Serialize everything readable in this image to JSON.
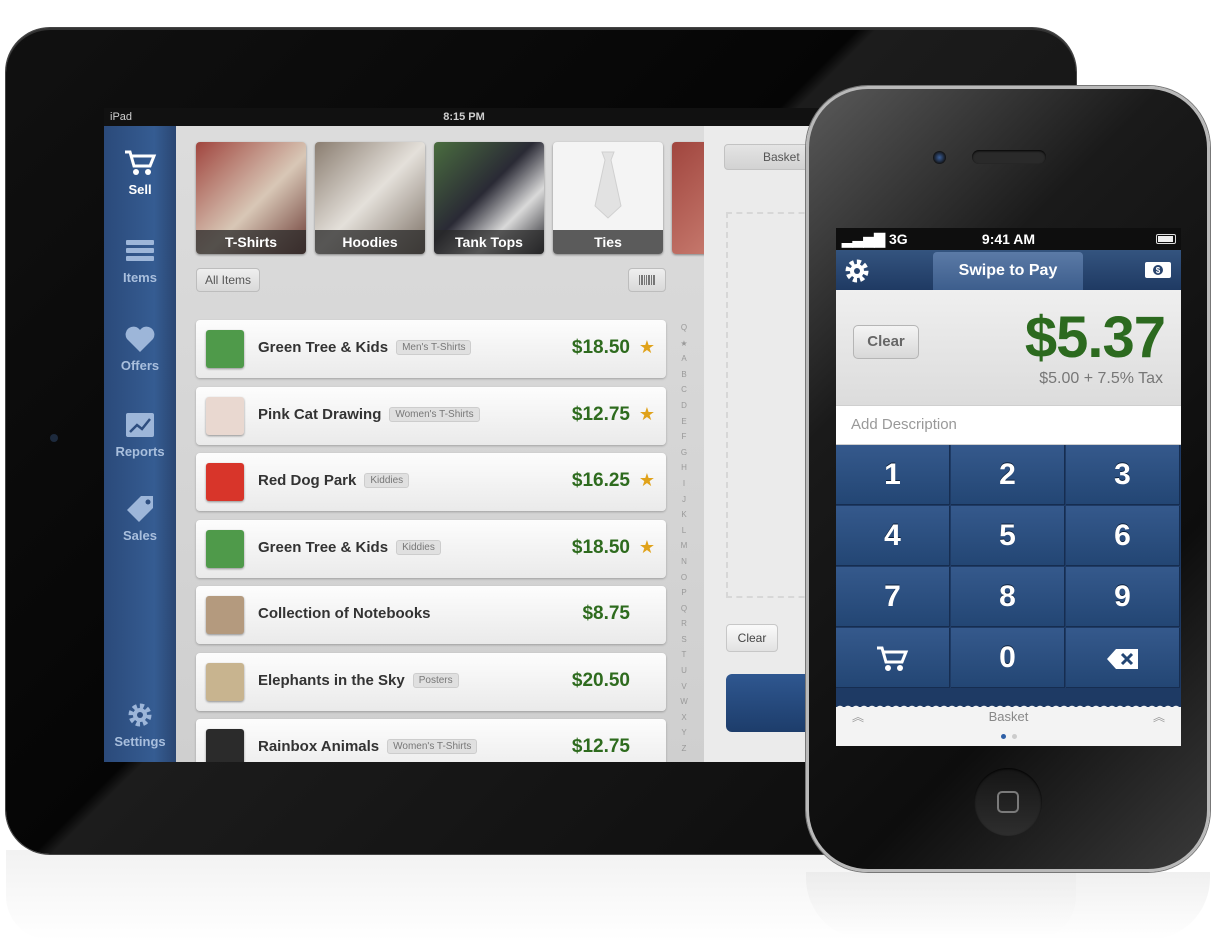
{
  "ipad": {
    "status": {
      "carrier": "iPad",
      "time": "8:15 PM"
    },
    "sidebar": [
      {
        "label": "Sell",
        "icon": "cart-icon",
        "active": true
      },
      {
        "label": "Items",
        "icon": "list-icon"
      },
      {
        "label": "Offers",
        "icon": "heart-icon"
      },
      {
        "label": "Reports",
        "icon": "chart-icon"
      },
      {
        "label": "Sales",
        "icon": "tag-icon"
      },
      {
        "label": "Settings",
        "icon": "gear-icon"
      }
    ],
    "categories": [
      "T-Shirts",
      "Hoodies",
      "Tank Tops",
      "Ties"
    ],
    "filter_label": "All Items",
    "items": [
      {
        "name": "Green Tree & Kids",
        "tag": "Men's T-Shirts",
        "price": "$18.50",
        "favorite": true,
        "color": "#4f9a4a"
      },
      {
        "name": "Pink Cat Drawing",
        "tag": "Women's T-Shirts",
        "price": "$12.75",
        "favorite": true,
        "color": "#e9d8d0"
      },
      {
        "name": "Red Dog Park",
        "tag": "Kiddies",
        "price": "$16.25",
        "favorite": true,
        "color": "#d8352a"
      },
      {
        "name": "Green Tree & Kids",
        "tag": "Kiddies",
        "price": "$18.50",
        "favorite": true,
        "color": "#4f9a4a"
      },
      {
        "name": "Collection of Notebooks",
        "tag": "",
        "price": "$8.75",
        "favorite": false,
        "color": "#b49a7e"
      },
      {
        "name": "Elephants in the Sky",
        "tag": "Posters",
        "price": "$20.50",
        "favorite": false,
        "color": "#c8b48f"
      },
      {
        "name": "Rainbox Animals",
        "tag": "Women's T-Shirts",
        "price": "$12.75",
        "favorite": false,
        "color": "#2b2b2b"
      }
    ],
    "alphabet": [
      "Q",
      "★",
      "A",
      "B",
      "C",
      "D",
      "E",
      "F",
      "G",
      "H",
      "I",
      "J",
      "K",
      "L",
      "M",
      "N",
      "O",
      "P",
      "Q",
      "R",
      "S",
      "T",
      "U",
      "V",
      "W",
      "X",
      "Y",
      "Z"
    ],
    "basket_tab": "Basket",
    "basket_clear": "Clear"
  },
  "iphone": {
    "status": {
      "carrier": "3G",
      "time": "9:41 AM"
    },
    "tab_label": "Swipe to Pay",
    "clear_label": "Clear",
    "amount": "$5.37",
    "tax_line": "$5.00 + 7.5% Tax",
    "description_placeholder": "Add Description",
    "keys": [
      "1",
      "2",
      "3",
      "4",
      "5",
      "6",
      "7",
      "8",
      "9",
      "cart",
      "0",
      "backspace"
    ],
    "basket_label": "Basket"
  },
  "colors": {
    "accent": "#2e6b1e",
    "navy": "#2b4a7a",
    "star": "#e0a21a"
  }
}
